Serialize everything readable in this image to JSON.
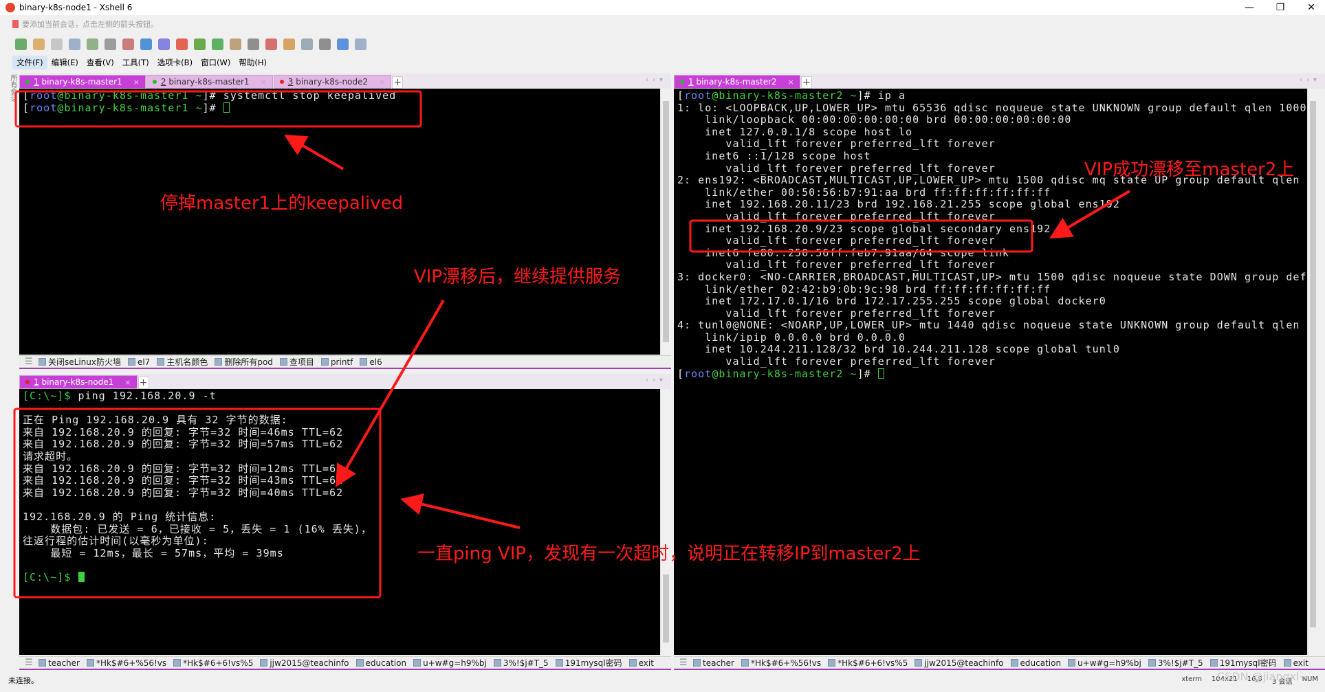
{
  "window": {
    "title": "binary-k8s-node1 - Xshell 6",
    "controls": [
      "—",
      "❐",
      "✕"
    ]
  },
  "address_bar": {
    "hint": "要添加当前会话，点击左侧的箭头按钮。"
  },
  "toolbar": {
    "icons": [
      "new-session-icon",
      "open-folder-icon",
      "disconnect-icon",
      "reconnect-icon",
      "properties-icon",
      "find-icon",
      "transfer-icon",
      "globe-icon",
      "font-icon",
      "xshell-icon",
      "xftp-icon",
      "fullscreen-icon",
      "lock-icon",
      "keyboard-icon",
      "highlight-icon",
      "compose-icon",
      "layout-icon",
      "settings-icon",
      "help-icon",
      "chat-icon"
    ]
  },
  "menu": [
    "文件(F)",
    "编辑(E)",
    "查看(V)",
    "工具(T)",
    "选项卡(B)",
    "窗口(W)",
    "帮助(H)"
  ],
  "sidebar_label": "所有会话",
  "left_top": {
    "tabs": [
      {
        "num": "1",
        "label": "binary-k8s-master1",
        "status": "#22c022",
        "active": true
      },
      {
        "num": "2",
        "label": "binary-k8s-master1",
        "status": "#22c022",
        "active": false
      },
      {
        "num": "3",
        "label": "binary-k8s-node2",
        "status": "#e82020",
        "active": false
      }
    ],
    "lines": [
      {
        "prompt": [
          "[",
          "root",
          "@binary-k8s-master1 ~",
          "]#"
        ],
        "text": " systemctl stop keepalived"
      },
      {
        "prompt": [
          "[",
          "root",
          "@binary-k8s-master1 ~",
          "]#"
        ],
        "text": " ",
        "cursor": "hollow"
      }
    ]
  },
  "quickbar_top": [
    "关闭seLinux防火墙",
    "el7",
    "主机名颜色",
    "删除所有pod",
    "查项目",
    "printf",
    "el6"
  ],
  "left_bottom": {
    "tabs": [
      {
        "num": "1",
        "label": "binary-k8s-node1",
        "status": "#e82020",
        "active": true
      }
    ],
    "lines": [
      {
        "gprompt": "[C:\\~]$",
        "text": " ping 192.168.20.9 -t"
      },
      {
        "text": ""
      },
      {
        "text": "正在 Ping 192.168.20.9 具有 32 字节的数据:"
      },
      {
        "text": "来自 192.168.20.9 的回复: 字节=32 时间=46ms TTL=62"
      },
      {
        "text": "来自 192.168.20.9 的回复: 字节=32 时间=57ms TTL=62"
      },
      {
        "text": "请求超时。"
      },
      {
        "text": "来自 192.168.20.9 的回复: 字节=32 时间=12ms TTL=62"
      },
      {
        "text": "来自 192.168.20.9 的回复: 字节=32 时间=43ms TTL=62"
      },
      {
        "text": "来自 192.168.20.9 的回复: 字节=32 时间=40ms TTL=62"
      },
      {
        "text": ""
      },
      {
        "text": "192.168.20.9 的 Ping 统计信息:"
      },
      {
        "text": "    数据包: 已发送 = 6，已接收 = 5，丢失 = 1 (16% 丢失)，"
      },
      {
        "text": "往返行程的估计时间(以毫秒为单位):"
      },
      {
        "text": "    最短 = 12ms，最长 = 57ms，平均 = 39ms"
      },
      {
        "text": ""
      },
      {
        "gprompt": "[C:\\~]$",
        "text": " ",
        "cursor": "solid"
      }
    ]
  },
  "right": {
    "tabs": [
      {
        "num": "1",
        "label": "binary-k8s-master2",
        "status": "#22c022",
        "active": true
      }
    ],
    "lines": [
      {
        "prompt": [
          "[",
          "root",
          "@binary-k8s-master2 ~",
          "]#"
        ],
        "text": " ip a"
      },
      {
        "text": "1: lo: <LOOPBACK,UP,LOWER_UP> mtu 65536 qdisc noqueue state UNKNOWN group default qlen 1000"
      },
      {
        "text": "    link/loopback 00:00:00:00:00:00 brd 00:00:00:00:00:00"
      },
      {
        "text": "    inet 127.0.0.1/8 scope host lo"
      },
      {
        "text": "       valid_lft forever preferred_lft forever"
      },
      {
        "text": "    inet6 ::1/128 scope host"
      },
      {
        "text": "       valid_lft forever preferred_lft forever"
      },
      {
        "text": "2: ens192: <BROADCAST,MULTICAST,UP,LOWER_UP> mtu 1500 qdisc mq state UP group default qlen 1000"
      },
      {
        "text": "    link/ether 00:50:56:b7:91:aa brd ff:ff:ff:ff:ff:ff"
      },
      {
        "text": "    inet 192.168.20.11/23 brd 192.168.21.255 scope global ens192"
      },
      {
        "text": "       valid_lft forever preferred_lft forever"
      },
      {
        "text": "    inet 192.168.20.9/23 scope global secondary ens192"
      },
      {
        "text": "       valid_lft forever preferred_lft forever"
      },
      {
        "text": "    inet6 fe80::250:56ff:feb7:91aa/64 scope link"
      },
      {
        "text": "       valid_lft forever preferred_lft forever"
      },
      {
        "text": "3: docker0: <NO-CARRIER,BROADCAST,MULTICAST,UP> mtu 1500 qdisc noqueue state DOWN group default"
      },
      {
        "text": "    link/ether 02:42:b9:0b:9c:98 brd ff:ff:ff:ff:ff:ff"
      },
      {
        "text": "    inet 172.17.0.1/16 brd 172.17.255.255 scope global docker0"
      },
      {
        "text": "       valid_lft forever preferred_lft forever"
      },
      {
        "text": "4: tunl0@NONE: <NOARP,UP,LOWER_UP> mtu 1440 qdisc noqueue state UNKNOWN group default qlen 1000"
      },
      {
        "text": "    link/ipip 0.0.0.0 brd 0.0.0.0"
      },
      {
        "text": "    inet 10.244.211.128/32 brd 10.244.211.128 scope global tunl0"
      },
      {
        "text": "       valid_lft forever preferred_lft forever"
      },
      {
        "prompt": [
          "[",
          "root",
          "@binary-k8s-master2 ~",
          "]#"
        ],
        "text": " ",
        "cursor": "hollow"
      }
    ]
  },
  "quickbar_bottom": [
    "teacher",
    "*Hk$#6+%56!vs",
    "*Hk$#6+6!vs%5",
    "jjw2015@teachinfo",
    "education",
    "u+w#g=h9%bj",
    "3%!$j#T_5",
    "191mysql密码",
    "exit"
  ],
  "status": {
    "left": "未连接。",
    "term": "xterm",
    "size": "104x21",
    "pos": "16,9",
    "sessions": "3 会话",
    "num": "NUM"
  },
  "annotations": {
    "stop": "停掉master1上的keepalived",
    "vip_float": "VIP漂移后，继续提供服务",
    "vip_moved": "VIP成功漂移至master2上",
    "ping": "一直ping VIP，发现有一次超时，说明正在转移IP到master2上",
    "color": "#ff1a1a"
  },
  "watermark": "CSDN @jiangxl~"
}
